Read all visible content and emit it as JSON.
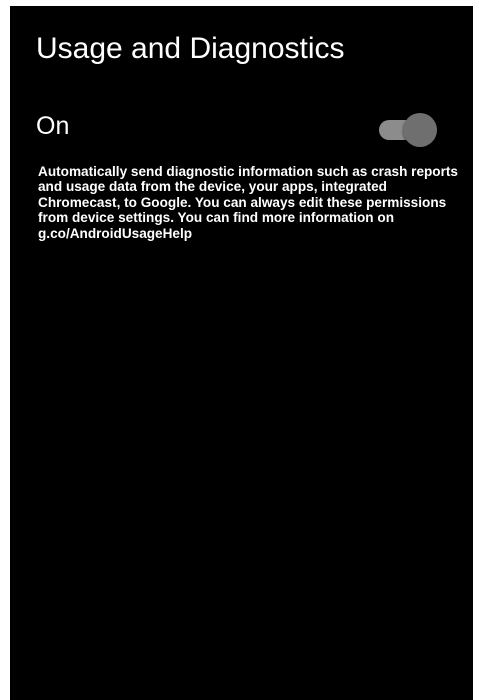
{
  "screen": {
    "title": "Usage and Diagnostics",
    "setting": {
      "label": "On",
      "toggle_state": "on"
    },
    "description": "Automatically send diagnostic information such as crash reports and usage data from the device, your apps, integrated Chromecast, to Google. You can always edit these permissions from device settings. You can find more information on g.co/AndroidUsageHelp"
  },
  "colors": {
    "background": "#000000",
    "text": "#ffffff",
    "toggle_track": "#8c8c8c",
    "toggle_thumb": "#6f6f6f"
  }
}
